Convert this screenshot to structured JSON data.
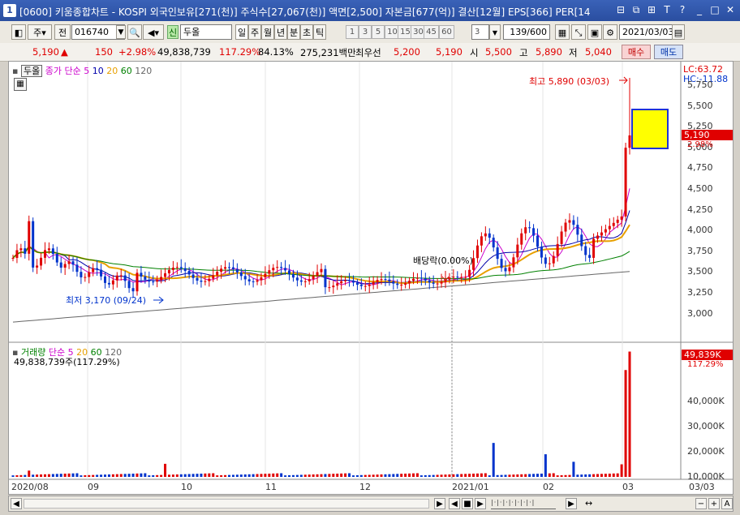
{
  "window": {
    "number": "1",
    "title": "[0600] 키움종합차트 - KOSPI 외국인보유[271(천)] 주식수[27,067(천)] 액면[2,500] 자본금[677(억)] 결산[12월] EPS[366] PER[14"
  },
  "toolbar": {
    "type_label": "주",
    "prev_label": "전",
    "code": "016740",
    "new_badge": "신",
    "stock_name": "두올",
    "periods": [
      "일",
      "주",
      "월",
      "년",
      "분",
      "초",
      "틱"
    ],
    "active_period": "일",
    "minutes": [
      "1",
      "3",
      "5",
      "10",
      "15",
      "30",
      "45",
      "60"
    ],
    "count_value": "3",
    "range": "139/600",
    "date": "2021/03/03"
  },
  "quote": {
    "price": "5,190",
    "change_arrow": "▲",
    "change": "150",
    "change_pct": "+2.98%",
    "volume": "49,838,739",
    "vol_ratio": "117.29%",
    "turnover": "84.13%",
    "amount": "275,231백만",
    "best_bid_label": "최우선",
    "best_ask": "5,200",
    "best_bid": "5,190",
    "open_label": "시",
    "open": "5,500",
    "high_label": "고",
    "high": "5,890",
    "low_label": "저",
    "low": "5,040",
    "buy_label": "매수",
    "sell_label": "매도"
  },
  "price_panel": {
    "stock_tab": "두올",
    "legend_title": "종가 단순",
    "ma_periods": [
      "5",
      "10",
      "20",
      "60",
      "120"
    ],
    "high_annotation": "최고 5,890 (03/03)",
    "low_annotation": "최저 3,170 (09/24)",
    "dividend_annotation": "배당락(0.00%)",
    "lc": "LC:63.72",
    "hc": "HC:-11.88",
    "current_price_tag": "5,190",
    "current_pct_tag": "2.98%",
    "y_ticks": [
      "5,750",
      "5,500",
      "5,250",
      "5,000",
      "4,750",
      "4,500",
      "4,250",
      "4,000",
      "3,750",
      "3,500",
      "3,250",
      "3,000"
    ]
  },
  "volume_panel": {
    "legend_title": "거래량",
    "legend_ma": "단순",
    "ma_periods": [
      "5",
      "20",
      "60",
      "120"
    ],
    "current_volume": "49,838,739주(117.29%)",
    "volume_tag": "49,839K",
    "volume_pct_tag": "117.29%",
    "y_ticks": [
      "40,000K",
      "30,000K",
      "20,000K",
      "10,000K"
    ]
  },
  "x_axis": {
    "labels": [
      "2020/08",
      "09",
      "10",
      "11",
      "12",
      "2021/01",
      "02",
      "03"
    ],
    "right_label": "03/03"
  },
  "colors": {
    "up": "#e00000",
    "down": "#0033cc",
    "ma5": "#cc00cc",
    "ma10": "#0000aa",
    "ma20": "#e8a000",
    "ma60": "#008000",
    "ma120": "#666666",
    "cursor_fill": "#ffff00"
  }
}
